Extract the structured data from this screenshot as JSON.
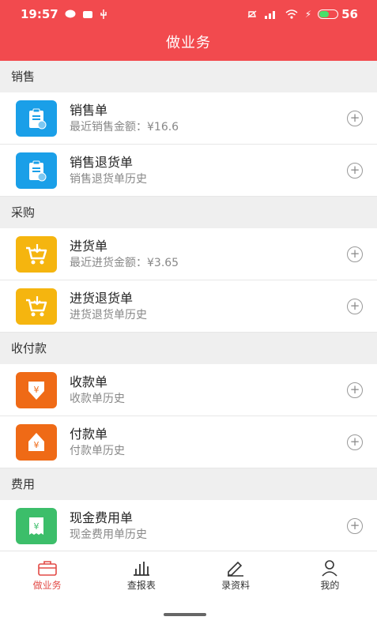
{
  "status_bar": {
    "time": "19:57",
    "battery": "56"
  },
  "header": {
    "title": "做业务"
  },
  "sections": [
    {
      "title": "销售",
      "items": [
        {
          "title": "销售单",
          "subtitle": "最近销售金额：¥16.6",
          "color": "#1a9fe8"
        },
        {
          "title": "销售退货单",
          "subtitle": "销售退货单历史",
          "color": "#1a9fe8"
        }
      ]
    },
    {
      "title": "采购",
      "items": [
        {
          "title": "进货单",
          "subtitle": "最近进货金额：¥3.65",
          "color": "#f5b50f"
        },
        {
          "title": "进货退货单",
          "subtitle": "进货退货单历史",
          "color": "#f5b50f"
        }
      ]
    },
    {
      "title": "收付款",
      "items": [
        {
          "title": "收款单",
          "subtitle": "收款单历史",
          "color": "#ef6a16"
        },
        {
          "title": "付款单",
          "subtitle": "付款单历史",
          "color": "#ef6a16"
        }
      ]
    },
    {
      "title": "费用",
      "items": [
        {
          "title": "现金费用单",
          "subtitle": "现金费用单历史",
          "color": "#3cbe6a"
        }
      ]
    }
  ],
  "tabs": [
    {
      "label": "做业务",
      "active": true
    },
    {
      "label": "查报表"
    },
    {
      "label": "录资料"
    },
    {
      "label": "我的"
    }
  ],
  "colors": {
    "accent": "#f24a4e"
  }
}
